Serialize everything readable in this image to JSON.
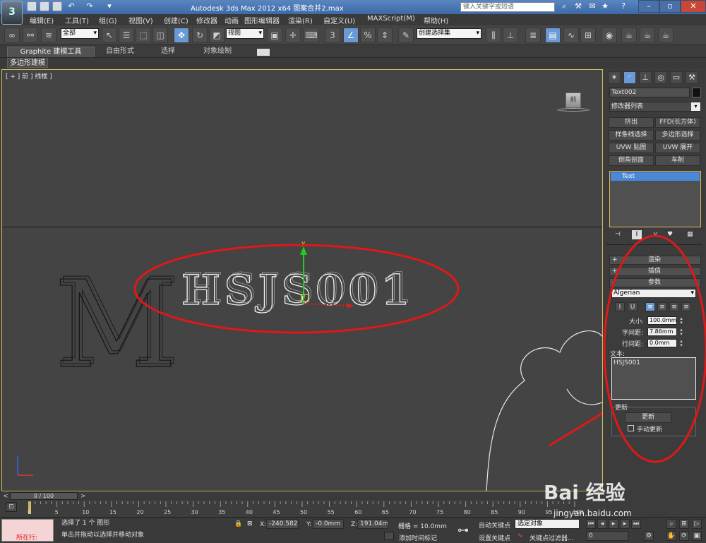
{
  "app": {
    "title": "Autodesk 3ds Max  2012 x64       图案合并2.max",
    "search_placeholder": "键入关键字或短语",
    "logo": "3ds-max-logo"
  },
  "menu": [
    "编辑(E)",
    "工具(T)",
    "组(G)",
    "视图(V)",
    "创建(C)",
    "修改器",
    "动画",
    "图形编辑器",
    "渲染(R)",
    "自定义(U)",
    "MAXScript(M)",
    "帮助(H)"
  ],
  "toolbar": {
    "selection_filter": "全部",
    "reference_coord": "视图",
    "named_selection": "创建选择集",
    "snap_label": "3"
  },
  "ribbon": {
    "tabs": [
      "Graphite 建模工具",
      "自由形式",
      "选择",
      "对象绘制"
    ],
    "subtab": "多边形建模"
  },
  "viewport": {
    "label": "[ + ] 前 ] 线框 ]",
    "text_object": "HSJS001",
    "bg_text": "M",
    "gizmo_label": "y",
    "viewcube_label": "前"
  },
  "command_panel": {
    "object_name": "Text002",
    "modifier_list": "修改器列表",
    "modifier_buttons": [
      "挤出",
      "FFD(长方体)",
      "样条线选择",
      "多边形选择",
      "UVW 贴图",
      "UVW 展开",
      "倒角剖面",
      "车削"
    ],
    "stack_items": [
      "Text"
    ],
    "rollouts": {
      "render": "渲染",
      "interp": "插值",
      "params": "参数",
      "update": "更新"
    },
    "font": "Algerian",
    "size_label": "大小:",
    "size_value": "100.0mm",
    "kerning_label": "字间距:",
    "kerning_value": "7.86mm",
    "leading_label": "行间距:",
    "leading_value": "0.0mm",
    "text_label": "文本:",
    "text_value": "HSJS001",
    "update_button": "更新",
    "manual_update": "手动更新",
    "style_buttons": [
      "I",
      "U",
      "≡",
      "≡",
      "≡",
      "≡"
    ]
  },
  "timeline": {
    "frame_display": "0 / 100",
    "ticks": [
      "0",
      "5",
      "10",
      "15",
      "20",
      "25",
      "30",
      "35",
      "40",
      "45",
      "50",
      "55",
      "60",
      "65",
      "70",
      "75",
      "80",
      "85",
      "90",
      "95",
      "100"
    ]
  },
  "status": {
    "script_label": "所在行:",
    "selected": "选择了 1 个 图形",
    "prompt": "单击并拖动以选择并移动对象",
    "x_label": "X:",
    "x_value": "-240.582m",
    "y_label": "Y:",
    "y_value": "-0.0mm",
    "z_label": "Z:",
    "z_value": "191.04mm",
    "grid": "栅格 = 10.0mm",
    "add_time_tag": "添加时间标记",
    "auto_key": "自动关键点",
    "set_key": "设置关键点",
    "selected_obj": "选定对象",
    "key_filter": "关键点过滤器...",
    "frame_value": "0"
  },
  "watermark": {
    "brand": "Bai 经验",
    "url": "jingyan.baidu.com"
  },
  "colors": {
    "annotation": "#e01818",
    "selection_highlight": "#d8c060",
    "active_button": "#6a9ad6"
  }
}
